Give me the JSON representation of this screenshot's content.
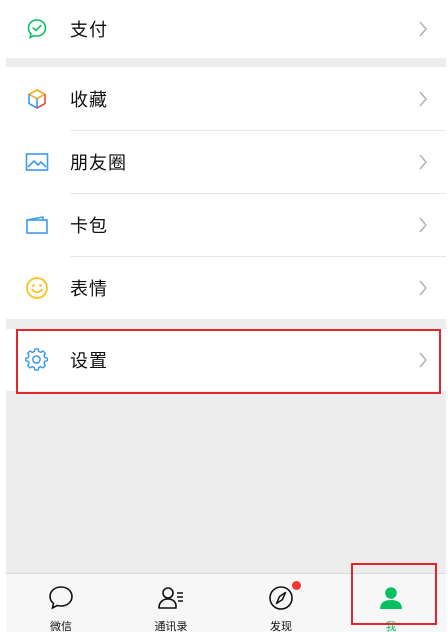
{
  "menu": {
    "pay": {
      "label": "支付",
      "icon": "pay-icon"
    },
    "favorites": {
      "label": "收藏",
      "icon": "favorites-cube-icon"
    },
    "moments": {
      "label": "朋友圈",
      "icon": "moments-image-icon"
    },
    "cards": {
      "label": "卡包",
      "icon": "card-wallet-icon"
    },
    "stickers": {
      "label": "表情",
      "icon": "smiley-face-icon"
    },
    "settings": {
      "label": "设置",
      "icon": "gear-icon"
    }
  },
  "tabbar": {
    "tabs": [
      {
        "label": "微信",
        "icon": "chat-bubble-icon",
        "active": false
      },
      {
        "label": "通讯录",
        "icon": "contacts-icon",
        "active": false
      },
      {
        "label": "发现",
        "icon": "compass-icon",
        "active": false,
        "badge": true
      },
      {
        "label": "我",
        "icon": "person-icon",
        "active": true
      }
    ]
  },
  "colors": {
    "accent_green": "#07c160",
    "highlight_red": "#e3262b",
    "badge_red": "#f43530",
    "background": "#ededed"
  }
}
